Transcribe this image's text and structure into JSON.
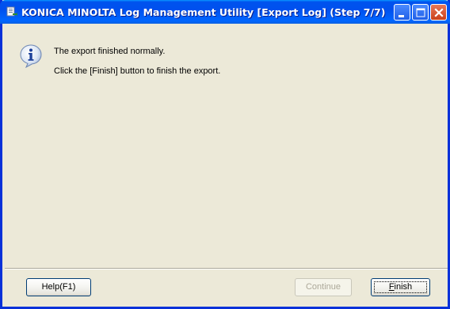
{
  "window": {
    "title": "KONICA MINOLTA Log Management Utility [Export Log] (Step 7/7)"
  },
  "icons": {
    "app": "app-icon",
    "message": "info-icon",
    "minimize": "minimize-icon",
    "maximize": "maximize-icon",
    "close": "close-icon"
  },
  "message": {
    "line1": "The export finished normally.",
    "line2": "Click the [Finish] button to finish the export."
  },
  "buttons": {
    "help": "Help(F1)",
    "continue": "Continue",
    "continue_enabled": false,
    "finish": "Finish",
    "finish_accesskey": "F"
  },
  "colors": {
    "titlebar": "#0054e3",
    "dialog_bg": "#ece9d8",
    "close_button": "#d9532c"
  }
}
